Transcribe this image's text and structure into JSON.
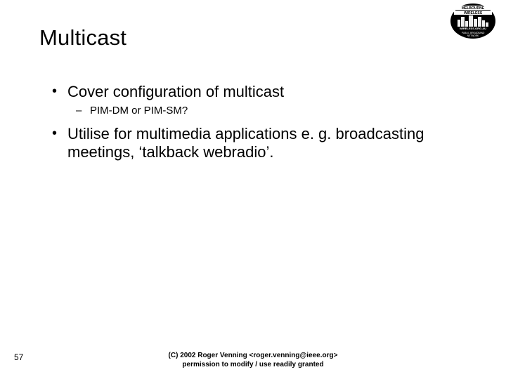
{
  "logo": {
    "name": "melbourne-wireless-logo",
    "top_text": "MELBOURNE",
    "mid_text": "WIRELESS",
    "sub_text": "WIRELESS.ORG.AU",
    "tag_text": "PUBLIC BROADBAND NETWORK"
  },
  "title": "Multicast",
  "bullets": [
    {
      "level": 1,
      "text": "Cover configuration of multicast"
    },
    {
      "level": 2,
      "text": "PIM-DM or PIM-SM?"
    },
    {
      "level": 1,
      "text": "Utilise for multimedia applications e. g. broadcasting meetings, ‘talkback webradio’."
    }
  ],
  "page_number": "57",
  "footer": {
    "line1": "(C) 2002 Roger Venning <roger.venning@ieee.org>",
    "line2": "permission to modify / use readily granted"
  }
}
